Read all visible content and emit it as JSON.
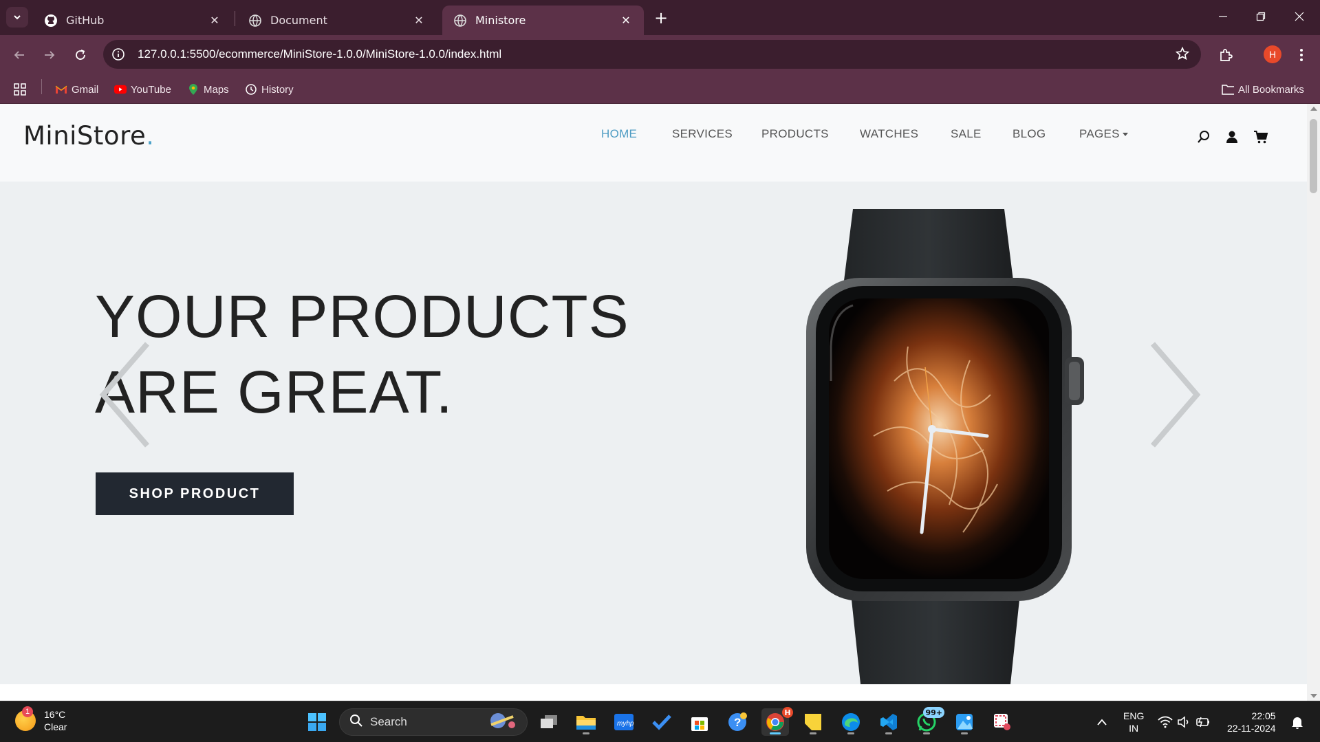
{
  "browser": {
    "tabs": [
      {
        "title": "GitHub",
        "icon": "github-icon",
        "active": false
      },
      {
        "title": "Document",
        "icon": "globe-icon",
        "active": false
      },
      {
        "title": "Ministore",
        "icon": "globe-icon",
        "active": true
      }
    ],
    "url": "127.0.0.1:5500/ecommerce/MiniStore-1.0.0/MiniStore-1.0.0/index.html",
    "profile_initial": "H",
    "bookmarks": [
      {
        "label": "Gmail",
        "icon": "gmail-icon"
      },
      {
        "label": "YouTube",
        "icon": "youtube-icon"
      },
      {
        "label": "Maps",
        "icon": "maps-icon"
      },
      {
        "label": "History",
        "icon": "history-icon"
      }
    ],
    "all_bookmarks_label": "All Bookmarks",
    "colors": {
      "frame": "#3b1e2e",
      "toolbar": "#5c3148"
    }
  },
  "site": {
    "logo_text": "MiniStore",
    "logo_dot": ".",
    "nav": [
      {
        "label": "HOME",
        "active": true
      },
      {
        "label": "SERVICES",
        "active": false
      },
      {
        "label": "PRODUCTS",
        "active": false
      },
      {
        "label": "WATCHES",
        "active": false
      },
      {
        "label": "SALE",
        "active": false
      },
      {
        "label": "BLOG",
        "active": false
      },
      {
        "label": "PAGES",
        "active": false,
        "dropdown": true
      }
    ],
    "header_icons": [
      "search-icon",
      "user-icon",
      "cart-icon"
    ],
    "hero": {
      "title_line1": "YOUR PRODUCTS",
      "title_line2": "ARE GREAT.",
      "button_label": "SHOP PRODUCT",
      "image": "smartwatch-product-image"
    },
    "colors": {
      "accent": "#4e9cc3",
      "button": "#222831",
      "hero_bg": "#edf0f2"
    }
  },
  "taskbar": {
    "weather": {
      "temp": "16°C",
      "condition": "Clear",
      "badge": "1"
    },
    "search_placeholder": "Search",
    "whatsapp_badge": "99+",
    "chrome_badge": "H",
    "language": {
      "line1": "ENG",
      "line2": "IN"
    },
    "time": "22:05",
    "date": "22-11-2024"
  }
}
